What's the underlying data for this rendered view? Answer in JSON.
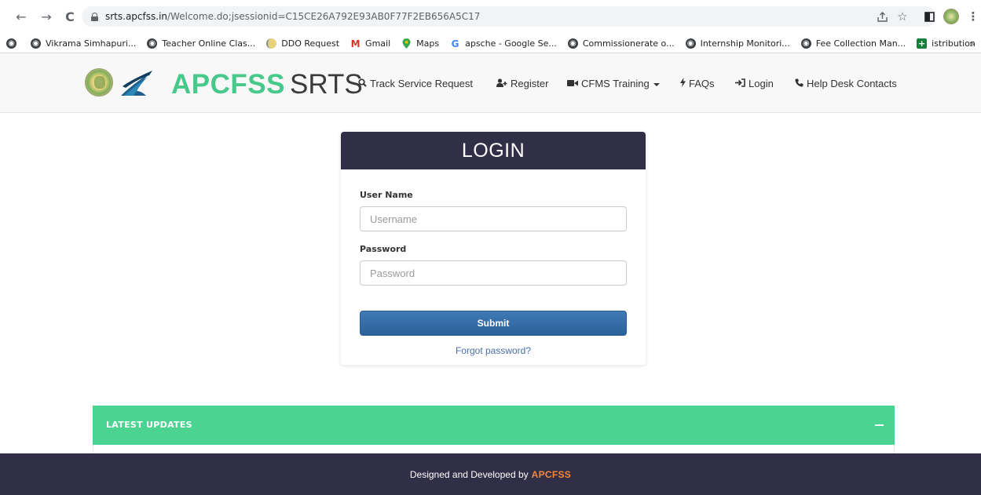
{
  "browser": {
    "url_host": "srts.apcfss.in",
    "url_path": "/Welcome.do;jsessionid=C15CE26A792E93AB0F77F2EB656A5C17",
    "bookmarks": [
      {
        "label": "Vikrama Simhapuri...",
        "icon": "globe-icon"
      },
      {
        "label": "Teacher Online Clas...",
        "icon": "globe-icon"
      },
      {
        "label": "DDO Request",
        "icon": "emblem-icon"
      },
      {
        "label": "Gmail",
        "icon": "gmail-icon"
      },
      {
        "label": "Maps",
        "icon": "maps-icon"
      },
      {
        "label": "apsche - Google Se...",
        "icon": "google-icon"
      },
      {
        "label": "Commissionerate o...",
        "icon": "globe-icon"
      },
      {
        "label": "Internship Monitori...",
        "icon": "globe-icon"
      },
      {
        "label": "Fee Collection Man...",
        "icon": "globe-icon"
      },
      {
        "label": "istribution",
        "icon": "sheets-plus-icon"
      }
    ],
    "more_label": "»"
  },
  "header": {
    "brand_primary": "APCFSS",
    "brand_secondary": "SRTS",
    "nav": {
      "track": "Track Service Request",
      "register": "Register",
      "training": "CFMS Training",
      "faqs": "FAQs",
      "login": "Login",
      "helpdesk": "Help Desk Contacts"
    }
  },
  "login": {
    "title": "LOGIN",
    "username_label": "User Name",
    "username_placeholder": "Username",
    "username_value": "",
    "password_label": "Password",
    "password_placeholder": "Password",
    "password_value": "",
    "submit_label": "Submit",
    "forgot_label": "Forgot password?"
  },
  "updates": {
    "title": "LATEST UPDATES",
    "toggle_symbol": "−"
  },
  "footer": {
    "text": "Designed and Developed by",
    "brand": "APCFSS"
  },
  "colors": {
    "brand_green": "#46c98b",
    "header_dark": "#312e47",
    "button_blue": "#2a619a",
    "footer_accent": "#f5893a",
    "updates_green": "#4bd391"
  }
}
